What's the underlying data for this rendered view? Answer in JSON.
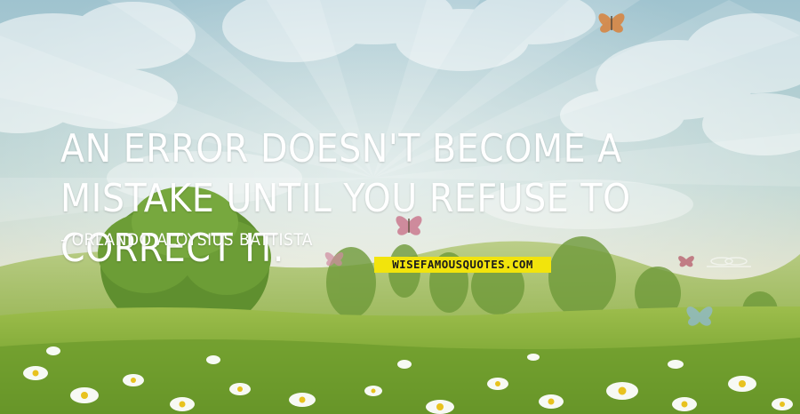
{
  "quote": {
    "text": "An error doesn't become a mistake until you refuse to correct it.",
    "author": "- Orlando Aloysius Battista"
  },
  "watermark": {
    "label": "WISEFAMOUSQUOTES.COM"
  },
  "colors": {
    "sky_top": "#9fc3cf",
    "sky_horizon": "#f2ecd2",
    "grass": "#7fa936",
    "text": "#ffffff",
    "badge": "#f2e40c"
  }
}
